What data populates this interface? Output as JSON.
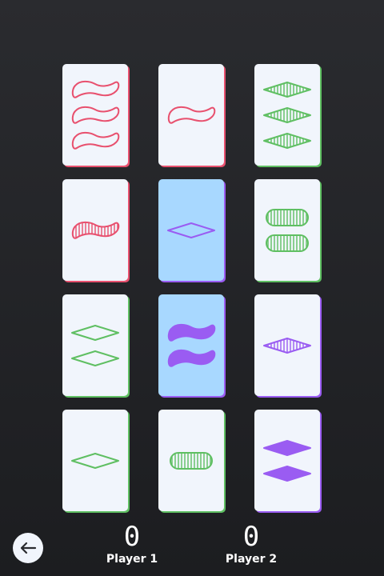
{
  "colors": {
    "red": "#e8506e",
    "green": "#5fbf62",
    "purple": "#9a5cf2",
    "blue_selected_card": "#a8d8ff"
  },
  "cards": [
    {
      "count": 3,
      "shape": "squiggle",
      "fill": "outline",
      "color": "red",
      "selected": false
    },
    {
      "count": 1,
      "shape": "squiggle",
      "fill": "outline",
      "color": "red",
      "selected": false
    },
    {
      "count": 3,
      "shape": "diamond",
      "fill": "striped",
      "color": "green",
      "selected": false
    },
    {
      "count": 1,
      "shape": "squiggle",
      "fill": "striped",
      "color": "red",
      "selected": false
    },
    {
      "count": 1,
      "shape": "diamond",
      "fill": "outline",
      "color": "purple",
      "selected": true
    },
    {
      "count": 2,
      "shape": "oval",
      "fill": "striped",
      "color": "green",
      "selected": false
    },
    {
      "count": 2,
      "shape": "diamond",
      "fill": "outline",
      "color": "green",
      "selected": false
    },
    {
      "count": 2,
      "shape": "squiggle",
      "fill": "solid",
      "color": "purple",
      "selected": true
    },
    {
      "count": 1,
      "shape": "diamond",
      "fill": "striped",
      "color": "purple",
      "selected": false
    },
    {
      "count": 1,
      "shape": "diamond",
      "fill": "outline",
      "color": "green",
      "selected": false
    },
    {
      "count": 1,
      "shape": "oval",
      "fill": "striped",
      "color": "green",
      "selected": false
    },
    {
      "count": 2,
      "shape": "diamond",
      "fill": "solid",
      "color": "purple",
      "selected": false
    }
  ],
  "back_button": {
    "icon": "arrow-left-icon"
  },
  "players": [
    {
      "score": "0",
      "label": "Player 1"
    },
    {
      "score": "0",
      "label": "Player 2"
    }
  ]
}
